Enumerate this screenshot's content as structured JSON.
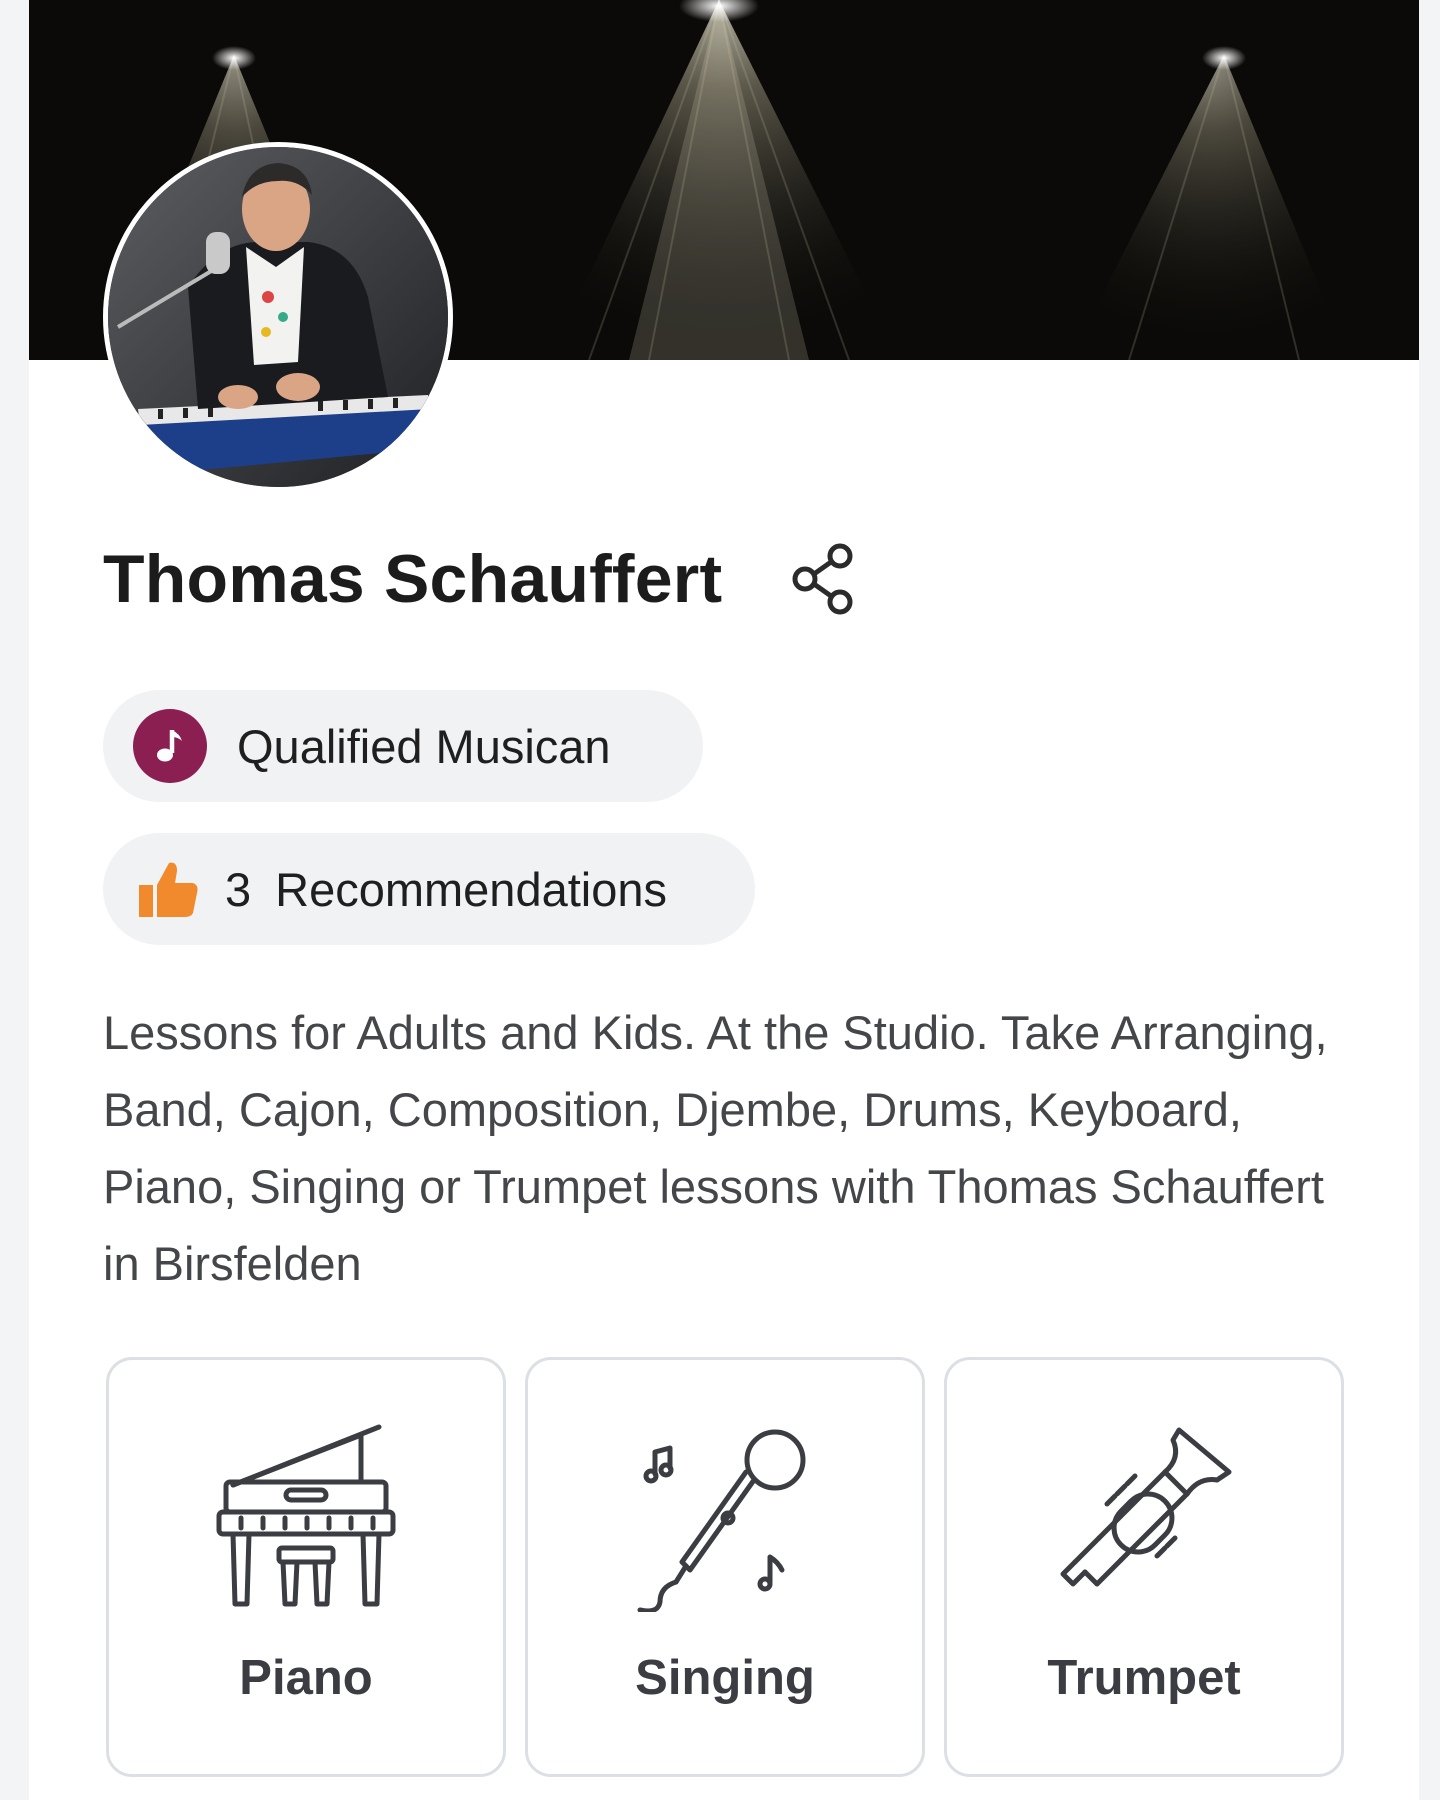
{
  "profile": {
    "name": "Thomas Schauffert",
    "badges": {
      "qualified_label": "Qualified Musican",
      "recommendations_count": "3",
      "recommendations_label": "Recommendations"
    },
    "description": "Lessons for Adults and Kids. At the Studio. Take Arranging, Band, Cajon, Composition, Djembe, Drums, Keyboard, Piano, Singing or Trumpet lessons with Thomas Schauffert in Birsfelden"
  },
  "instruments": [
    {
      "label": "Piano",
      "icon": "piano-icon"
    },
    {
      "label": "Singing",
      "icon": "microphone-icon"
    },
    {
      "label": "Trumpet",
      "icon": "trumpet-icon"
    }
  ],
  "icons": {
    "share": "share-icon",
    "qualified": "music-note-icon",
    "recommendations": "thumbs-up-icon"
  },
  "colors": {
    "qualified_badge": "#8c1f52",
    "thumbs_up": "#f08a2c",
    "chip_background": "#f1f2f4",
    "tile_border": "#dcdfe4"
  }
}
